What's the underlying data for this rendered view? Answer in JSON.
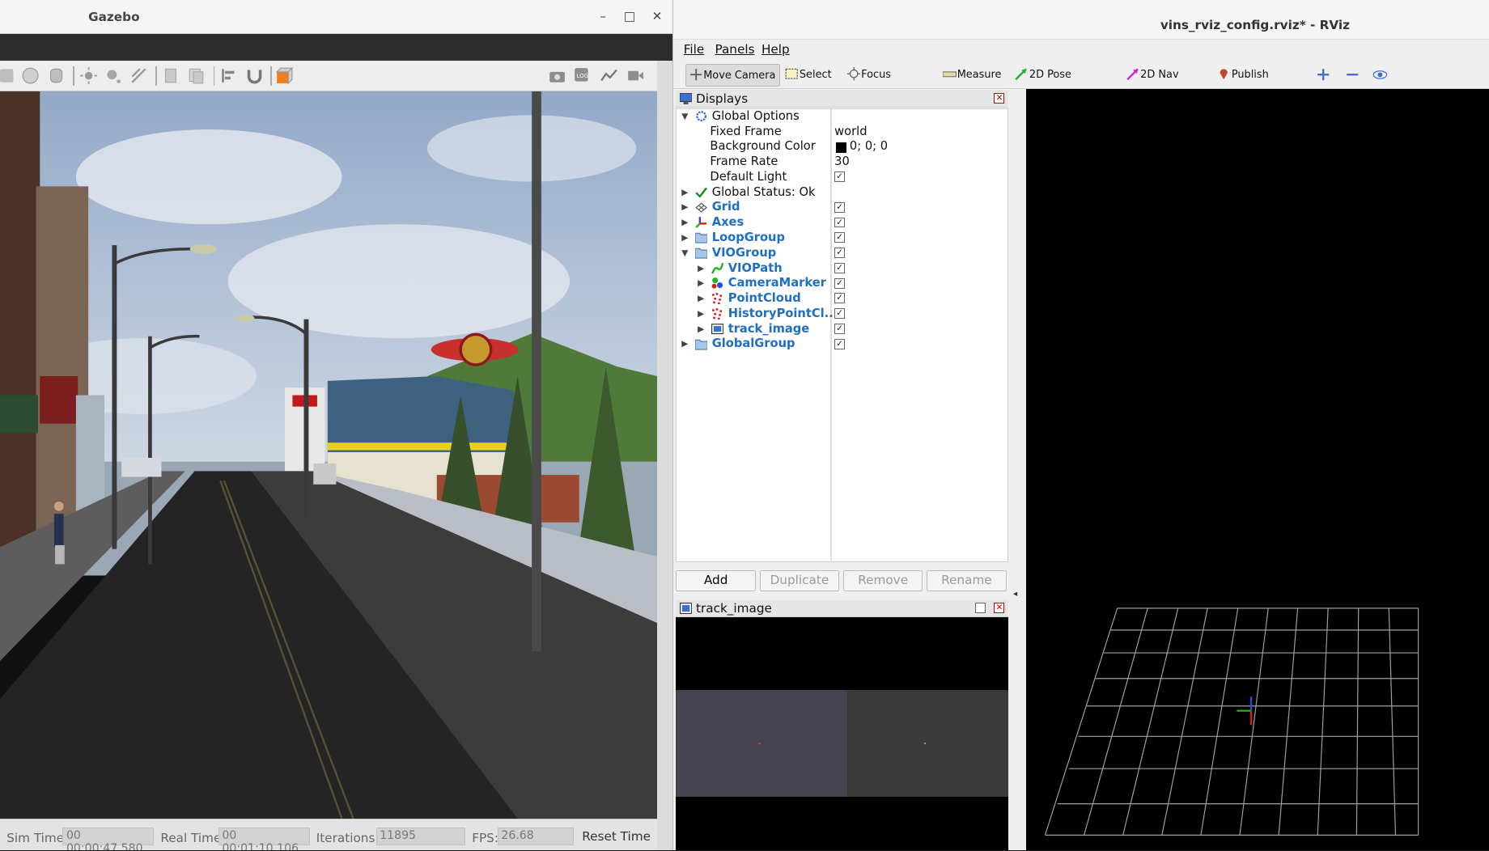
{
  "gazebo": {
    "window_title": "Gazebo",
    "window_controls": {
      "minimize": "–",
      "maximize": "□",
      "close": "✕"
    },
    "toolbar_icons": [
      "box-icon",
      "sphere-icon",
      "cylinder-icon",
      "sun-light-icon",
      "point-light-icon",
      "spot-light-icon",
      "copy-icon",
      "paste-icon",
      "align-icon",
      "magnet-snap-icon",
      "view-angle-icon",
      "screenshot-icon",
      "log-icon",
      "plot-icon",
      "record-video-icon"
    ],
    "status": {
      "sim_time_label": "Sim Time:",
      "sim_time_value": "00 00:00:47.580",
      "real_time_label": "Real Time:",
      "real_time_value": "00 00:01:10.106",
      "iterations_label": "Iterations:",
      "iterations_value": "11895",
      "fps_label": "FPS:",
      "fps_value": "26.68",
      "reset_label": "Reset Time"
    }
  },
  "rviz": {
    "window_title": "vins_rviz_config.rviz* - RViz",
    "menu": {
      "file": "File",
      "panels": "Panels",
      "help": "Help"
    },
    "tools": {
      "move_camera": "Move Camera",
      "select": "Select",
      "focus_camera": "Focus Camera",
      "measure": "Measure",
      "pose_estimate": "2D Pose Estimate",
      "nav_goal": "2D Nav Goal",
      "publish_point": "Publish Point"
    },
    "displays_panel": {
      "title": "Displays",
      "global_options": "Global Options",
      "fixed_frame_label": "Fixed Frame",
      "fixed_frame_value": "world",
      "bg_color_label": "Background Color",
      "bg_color_value": "0; 0; 0",
      "frame_rate_label": "Frame Rate",
      "frame_rate_value": "30",
      "default_light_label": "Default Light",
      "global_status": "Global Status: Ok",
      "grid": "Grid",
      "axes": "Axes",
      "loop_group": "LoopGroup",
      "vio_group": "VIOGroup",
      "vio_path": "VIOPath",
      "camera_marker": "CameraMarker",
      "point_cloud": "PointCloud",
      "history_point_cloud": "HistoryPointCl...",
      "track_image": "track_image",
      "global_group": "GlobalGroup",
      "check": "✓"
    },
    "buttons": {
      "add": "Add",
      "duplicate": "Duplicate",
      "remove": "Remove",
      "rename": "Rename"
    },
    "track_image_panel": {
      "title": "track_image"
    },
    "colors": {
      "accent_blue": "#1f6fc6",
      "grid_line": "#a0a0a0",
      "axis_x": "#ff0000",
      "axis_y": "#00ff00",
      "axis_z": "#0000ff"
    }
  }
}
